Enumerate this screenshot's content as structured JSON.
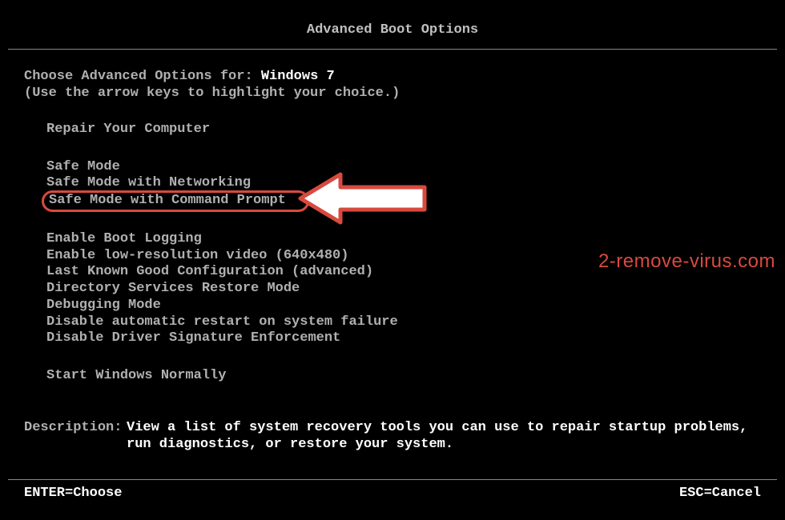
{
  "title": "Advanced Boot Options",
  "choose_prefix": "Choose Advanced Options for: ",
  "os_name": "Windows 7",
  "hint": "(Use the arrow keys to highlight your choice.)",
  "groups": {
    "repair": [
      "Repair Your Computer"
    ],
    "safe": [
      "Safe Mode",
      "Safe Mode with Networking",
      "Safe Mode with Command Prompt"
    ],
    "advanced": [
      "Enable Boot Logging",
      "Enable low-resolution video (640x480)",
      "Last Known Good Configuration (advanced)",
      "Directory Services Restore Mode",
      "Debugging Mode",
      "Disable automatic restart on system failure",
      "Disable Driver Signature Enforcement"
    ],
    "normal": [
      "Start Windows Normally"
    ]
  },
  "description_label": "Description:",
  "description_text": "View a list of system recovery tools you can use to repair startup problems, run diagnostics, or restore your system.",
  "footer": {
    "enter": "ENTER=Choose",
    "esc": "ESC=Cancel"
  },
  "watermark": "2-remove-virus.com",
  "highlight_color": "#d84a3f"
}
